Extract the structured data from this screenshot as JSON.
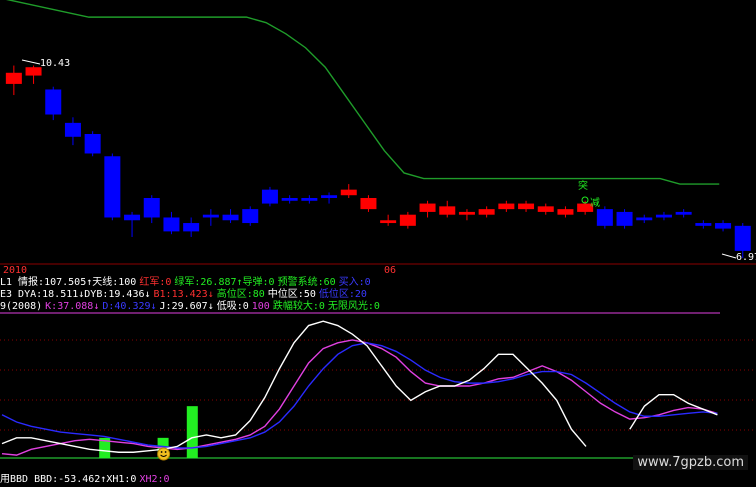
{
  "colors": {
    "background": "#000000",
    "up": "#ff0000",
    "down": "#0000ff",
    "ma_line": "#1f9c2a",
    "grid_red": "#8b0000",
    "white": "#ffffff",
    "magenta": "#e040e0",
    "blue_line": "#2a2aff",
    "green_bar": "#22ee22"
  },
  "main_chart": {
    "high_label": "10.43",
    "low_label": "6.97",
    "annotation_top": "突",
    "annotation_bottom": "减",
    "date_left": "2010",
    "date_mid": "06",
    "chart_data": {
      "type": "candlestick",
      "candles": [
        {
          "o": 10.1,
          "c": 10.3,
          "h": 10.43,
          "l": 9.9
        },
        {
          "o": 10.25,
          "c": 10.4,
          "h": 10.43,
          "l": 10.1
        },
        {
          "o": 10.0,
          "c": 9.55,
          "h": 10.05,
          "l": 9.45
        },
        {
          "o": 9.4,
          "c": 9.15,
          "h": 9.5,
          "l": 9.0
        },
        {
          "o": 9.2,
          "c": 8.85,
          "h": 9.25,
          "l": 8.8
        },
        {
          "o": 8.8,
          "c": 7.7,
          "h": 8.85,
          "l": 7.65
        },
        {
          "o": 7.75,
          "c": 7.65,
          "h": 7.8,
          "l": 7.35
        },
        {
          "o": 8.05,
          "c": 7.7,
          "h": 8.1,
          "l": 7.6
        },
        {
          "o": 7.7,
          "c": 7.45,
          "h": 7.8,
          "l": 7.4
        },
        {
          "o": 7.6,
          "c": 7.45,
          "h": 7.7,
          "l": 7.35
        },
        {
          "o": 7.75,
          "c": 7.7,
          "h": 7.85,
          "l": 7.55
        },
        {
          "o": 7.75,
          "c": 7.65,
          "h": 7.85,
          "l": 7.6
        },
        {
          "o": 7.85,
          "c": 7.6,
          "h": 7.9,
          "l": 7.55
        },
        {
          "o": 8.2,
          "c": 7.95,
          "h": 8.25,
          "l": 7.9
        },
        {
          "o": 8.05,
          "c": 8.0,
          "h": 8.1,
          "l": 7.95
        },
        {
          "o": 8.05,
          "c": 8.0,
          "h": 8.1,
          "l": 7.95
        },
        {
          "o": 8.1,
          "c": 8.05,
          "h": 8.15,
          "l": 7.95
        },
        {
          "o": 8.1,
          "c": 8.2,
          "h": 8.3,
          "l": 8.05
        },
        {
          "o": 7.85,
          "c": 8.05,
          "h": 8.1,
          "l": 7.8
        },
        {
          "o": 7.6,
          "c": 7.65,
          "h": 7.75,
          "l": 7.55
        },
        {
          "o": 7.55,
          "c": 7.75,
          "h": 7.8,
          "l": 7.5
        },
        {
          "o": 7.8,
          "c": 7.95,
          "h": 8.0,
          "l": 7.7
        },
        {
          "o": 7.75,
          "c": 7.9,
          "h": 8.0,
          "l": 7.7
        },
        {
          "o": 7.75,
          "c": 7.8,
          "h": 7.85,
          "l": 7.65
        },
        {
          "o": 7.75,
          "c": 7.85,
          "h": 7.9,
          "l": 7.7
        },
        {
          "o": 7.85,
          "c": 7.95,
          "h": 8.0,
          "l": 7.8
        },
        {
          "o": 7.85,
          "c": 7.95,
          "h": 8.0,
          "l": 7.8
        },
        {
          "o": 7.8,
          "c": 7.9,
          "h": 7.95,
          "l": 7.75
        },
        {
          "o": 7.75,
          "c": 7.85,
          "h": 7.9,
          "l": 7.7
        },
        {
          "o": 7.8,
          "c": 7.95,
          "h": 8.0,
          "l": 7.75
        },
        {
          "o": 7.85,
          "c": 7.55,
          "h": 7.9,
          "l": 7.5
        },
        {
          "o": 7.8,
          "c": 7.55,
          "h": 7.85,
          "l": 7.5
        },
        {
          "o": 7.7,
          "c": 7.65,
          "h": 7.75,
          "l": 7.6
        },
        {
          "o": 7.75,
          "c": 7.7,
          "h": 7.8,
          "l": 7.65
        },
        {
          "o": 7.8,
          "c": 7.75,
          "h": 7.85,
          "l": 7.7
        },
        {
          "o": 7.6,
          "c": 7.55,
          "h": 7.65,
          "l": 7.5
        },
        {
          "o": 7.6,
          "c": 7.5,
          "h": 7.65,
          "l": 7.45
        },
        {
          "o": 7.55,
          "c": 7.1,
          "h": 7.6,
          "l": 6.97
        }
      ],
      "ma_line": [
        11.3,
        11.3,
        11.3,
        11.3,
        11.3,
        11.3,
        11.3,
        11.3,
        11.3,
        11.2,
        11.0,
        10.75,
        10.4,
        9.9,
        9.4,
        8.9,
        8.5,
        8.4,
        8.4,
        8.4,
        8.4,
        8.4,
        8.4,
        8.4,
        8.4,
        8.4,
        8.4,
        8.4,
        8.4,
        8.4,
        8.3,
        8.3,
        8.3,
        8.3,
        8.3,
        8.28,
        8.27,
        8.26
      ],
      "ylim": [
        6.9,
        11.5
      ]
    }
  },
  "indicator_rows": [
    {
      "items": [
        {
          "text": "L1 情报:107.505↑天线:100",
          "color": "#ffffff"
        },
        {
          "text": "红军:0",
          "color": "#ff3030"
        },
        {
          "text": "绿军:26.887↑导弹:0",
          "color": "#22ee22"
        },
        {
          "text": "预警系统:60",
          "color": "#22ee22"
        },
        {
          "text": "买入:0",
          "color": "#3a3aff"
        }
      ]
    },
    {
      "items": [
        {
          "text": "E3 DYA:18.511↓DYB:19.436↓",
          "color": "#ffffff"
        },
        {
          "text": "B1:13.423↓",
          "color": "#ff3030"
        },
        {
          "text": "高位区:80",
          "color": "#22ee22"
        },
        {
          "text": "中位区:50",
          "color": "#ffffff"
        },
        {
          "text": "低位区:20",
          "color": "#3a3aff"
        }
      ]
    },
    {
      "items": [
        {
          "text": "9(2008)",
          "color": "#ffffff"
        },
        {
          "text": "K:37.088↓",
          "color": "#e040e0"
        },
        {
          "text": "D:40.329↓",
          "color": "#3a3aff"
        },
        {
          "text": "J:29.607↓",
          "color": "#ffffff"
        },
        {
          "text": "低吸:0",
          "color": "#ffffff"
        },
        {
          "text": "100",
          "color": "#e040e0"
        },
        {
          "text": "跌幅较大:0",
          "color": "#22ee22"
        },
        {
          "text": "无限风光:0",
          "color": "#22ee22"
        }
      ]
    }
  ],
  "kdj_chart": {
    "chart_data": {
      "type": "line",
      "ylim": [
        0,
        100
      ],
      "series": [
        {
          "name": "K",
          "color": "#e040e0",
          "values": [
            3,
            2,
            6,
            8,
            10,
            12,
            13,
            12,
            11,
            10,
            8,
            7,
            6,
            7,
            9,
            11,
            13,
            16,
            22,
            34,
            50,
            66,
            76,
            80,
            82,
            80,
            76,
            70,
            60,
            52,
            50,
            50,
            50,
            52,
            55,
            56,
            60,
            64,
            60,
            54,
            46,
            38,
            32,
            27,
            28,
            30,
            33,
            35,
            34,
            31
          ]
        },
        {
          "name": "D",
          "color": "#2a2aff",
          "values": [
            30,
            25,
            22,
            20,
            18,
            17,
            16,
            15,
            13,
            11,
            9,
            8,
            7,
            7,
            8,
            10,
            12,
            14,
            18,
            25,
            36,
            50,
            62,
            72,
            78,
            80,
            78,
            74,
            68,
            61,
            56,
            53,
            52,
            52,
            53,
            55,
            58,
            60,
            60,
            58,
            52,
            45,
            38,
            32,
            29,
            29,
            30,
            31,
            32,
            31
          ]
        },
        {
          "name": "J",
          "color": "#ffffff",
          "values": [
            10,
            14,
            14,
            12,
            10,
            8,
            6,
            5,
            4,
            4,
            5,
            6,
            8,
            14,
            16,
            14,
            16,
            26,
            42,
            62,
            80,
            92,
            95,
            92,
            86,
            78,
            64,
            50,
            40,
            46,
            50,
            50,
            54,
            62,
            72,
            72,
            62,
            52,
            40,
            20,
            8,
            null,
            null,
            20,
            36,
            44,
            44,
            38,
            34,
            30
          ]
        }
      ],
      "bars": [
        {
          "index": 7,
          "value": 14
        },
        {
          "index": 11,
          "value": 14
        },
        {
          "index": 13,
          "value": 36
        }
      ],
      "face_index": 11
    }
  },
  "bottom_row": [
    {
      "text": "用BBD BBD:-53.462↑XH1:0",
      "color": "#ffffff"
    },
    {
      "text": "XH2:0",
      "color": "#e040e0"
    }
  ],
  "watermark": "www.7gpzb.com"
}
